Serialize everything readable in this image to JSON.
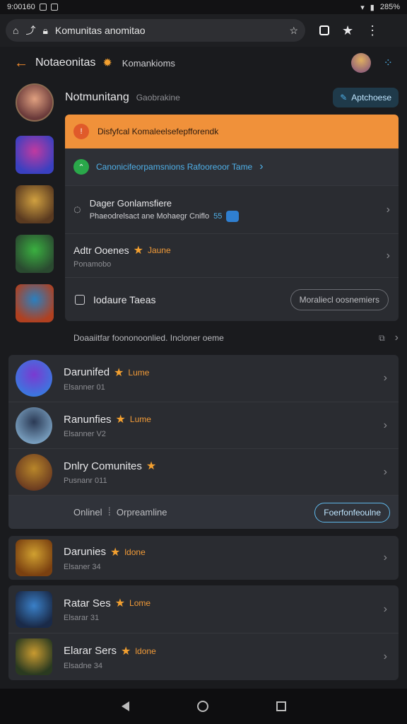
{
  "status": {
    "time": "9:00160",
    "battery": "285%"
  },
  "browser": {
    "url": "Komunitas anomitao"
  },
  "header": {
    "title": "Notaeonitas",
    "subtitle": "Komankioms"
  },
  "profile": {
    "name": "Notmunitang",
    "secondary": "Gaobrakine",
    "action_label": "Aptchoese"
  },
  "banner": {
    "text": "Disfyfcal Komaleelsefepfforendk"
  },
  "link_row": {
    "text": "Canonicifeorpamsnions Rafooreoor Tame"
  },
  "info_row": {
    "title": "Dager Gonlamsfiere",
    "subtitle": "Phaeodrelsact ane Mohaegr Cniflo",
    "badge": "55"
  },
  "game_row": {
    "title": "Adtr Ooenes",
    "tag": "Jaune",
    "subtitle": "Ponamobo"
  },
  "toggle_row": {
    "label": "Iodaure Taeas",
    "button": "Moraliecl oosnemiers"
  },
  "section": {
    "label": "Doaaiitfar foononoonlied. Incloner oeme"
  },
  "list_a": [
    {
      "title": "Darunifed",
      "tag": "Lume",
      "sub": "Elsanner 01",
      "colors": [
        "#7a3ad0",
        "#3a78e0"
      ]
    },
    {
      "title": "Ranunfies",
      "tag": "Lume",
      "sub": "Elsanner V2",
      "colors": [
        "#2b3a55",
        "#7aa0c0"
      ]
    },
    {
      "title": "Dnlry Comunites",
      "tag": "",
      "sub": "Pusnanr 011",
      "colors": [
        "#b8862a",
        "#6a3a20"
      ]
    }
  ],
  "online": {
    "label": "Onlinel",
    "extra": "Orpreamline",
    "button": "Foerfonfeoulne"
  },
  "list_b": [
    {
      "title": "Darunies",
      "tag": "ldone",
      "sub": "Elsaner 34",
      "colors": [
        "#d0a030",
        "#7a4010"
      ]
    }
  ],
  "list_c": [
    {
      "title": "Ratar Ses",
      "tag": "Lome",
      "sub": "Elsarar 31",
      "colors": [
        "#3a80c8",
        "#1a2a48"
      ]
    },
    {
      "title": "Elarar Sers",
      "tag": "ldone",
      "sub": "Elsadne 34",
      "colors": [
        "#c89a30",
        "#2a3a20"
      ]
    }
  ],
  "side_avatars": [
    {
      "colors": [
        "#c03aa0",
        "#3a40c0"
      ]
    },
    {
      "colors": [
        "#d0a040",
        "#5a3a20"
      ]
    },
    {
      "colors": [
        "#3ab040",
        "#2a4a30"
      ]
    },
    {
      "colors": [
        "#2a80c0",
        "#b04020"
      ]
    }
  ],
  "accent": "#f0913a",
  "link_color": "#4fb0e8"
}
